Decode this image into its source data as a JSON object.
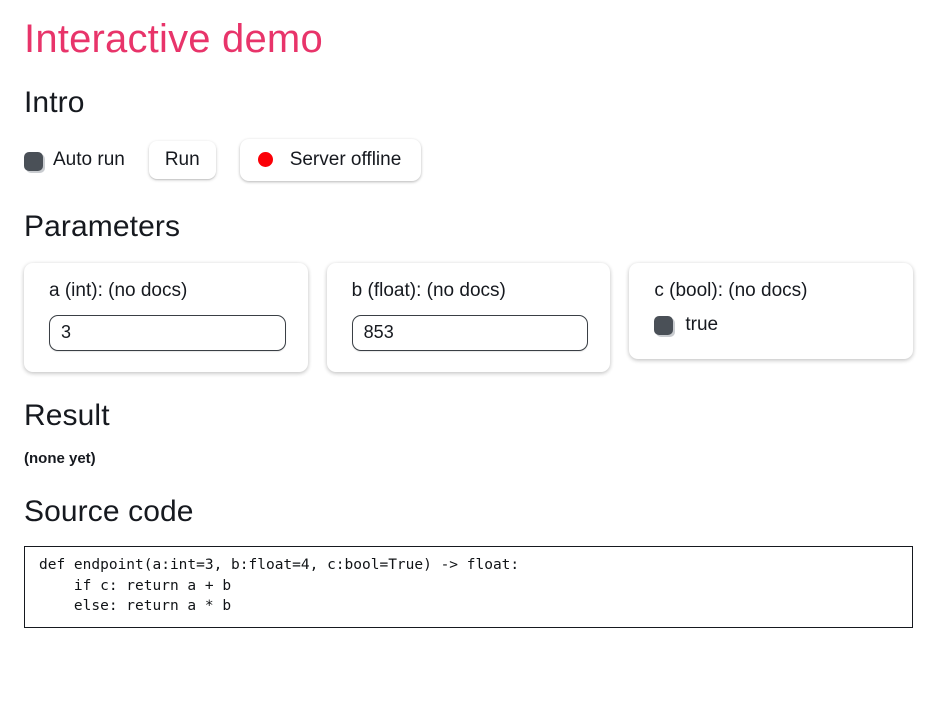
{
  "page": {
    "title": "Interactive demo"
  },
  "intro": {
    "heading": "Intro",
    "auto_run_label": "Auto run",
    "auto_run_checked": false,
    "run_button_label": "Run",
    "status_label": "Server offline",
    "status_dot_color": "#fb0007",
    "accent_color": "#e8346a"
  },
  "parameters": {
    "heading": "Parameters",
    "items": [
      {
        "label": "a (int): (no docs)",
        "name": "a",
        "type": "int",
        "doc": "(no docs)",
        "kind": "text",
        "value": "3",
        "placeholder": ""
      },
      {
        "label": "b (float): (no docs)",
        "name": "b",
        "type": "float",
        "doc": "(no docs)",
        "kind": "text",
        "value": "853",
        "placeholder": ""
      },
      {
        "label": "c (bool): (no docs)",
        "name": "c",
        "type": "bool",
        "doc": "(no docs)",
        "kind": "bool",
        "value": "true",
        "checked": false
      }
    ]
  },
  "result": {
    "heading": "Result",
    "text": "(none yet)"
  },
  "source": {
    "heading": "Source code",
    "code": "def endpoint(a:int=3, b:float=4, c:bool=True) -> float:\n    if c: return a + b\n    else: return a * b"
  }
}
